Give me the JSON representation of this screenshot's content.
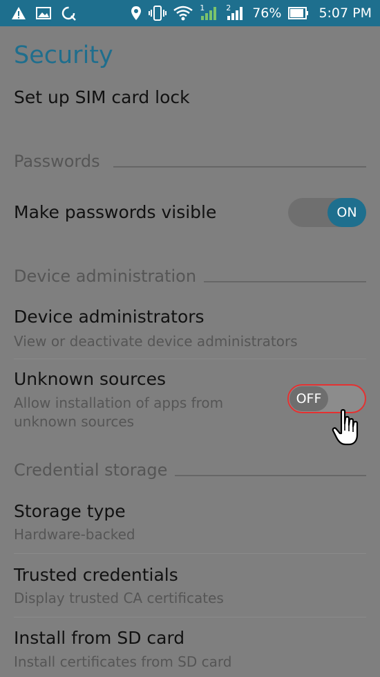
{
  "status_bar": {
    "battery": "76%",
    "time": "5:07 PM",
    "sim1": "1",
    "sim2": "2",
    "icons": [
      "warning-icon",
      "image-icon",
      "sync-icon",
      "location-icon",
      "vibrate-icon",
      "wifi-icon",
      "signal-icon",
      "battery-icon"
    ]
  },
  "header": {
    "title": "Security"
  },
  "items": {
    "sim_lock": {
      "title": "Set up SIM card lock"
    },
    "make_passwords_visible": {
      "title": "Make passwords visible",
      "toggle": "ON",
      "enabled": true
    },
    "device_admins": {
      "title": "Device administrators",
      "subtitle": "View or deactivate device administrators"
    },
    "unknown_sources": {
      "title": "Unknown sources",
      "subtitle_line1": "Allow installation of apps from",
      "subtitle_line2": "unknown sources",
      "toggle": "OFF",
      "enabled": false
    },
    "storage_type": {
      "title": "Storage type",
      "subtitle": "Hardware-backed"
    },
    "trusted_credentials": {
      "title": "Trusted credentials",
      "subtitle": "Display trusted CA certificates"
    },
    "install_sd": {
      "title": "Install from SD card",
      "subtitle": "Install certificates from SD card"
    }
  },
  "sections": {
    "passwords": "Passwords",
    "device_admin": "Device administration",
    "credential_storage": "Credential storage"
  },
  "colors": {
    "accent": "#1e6f8e",
    "highlight": "#e53131",
    "dim_background": "#7f7f7f"
  }
}
